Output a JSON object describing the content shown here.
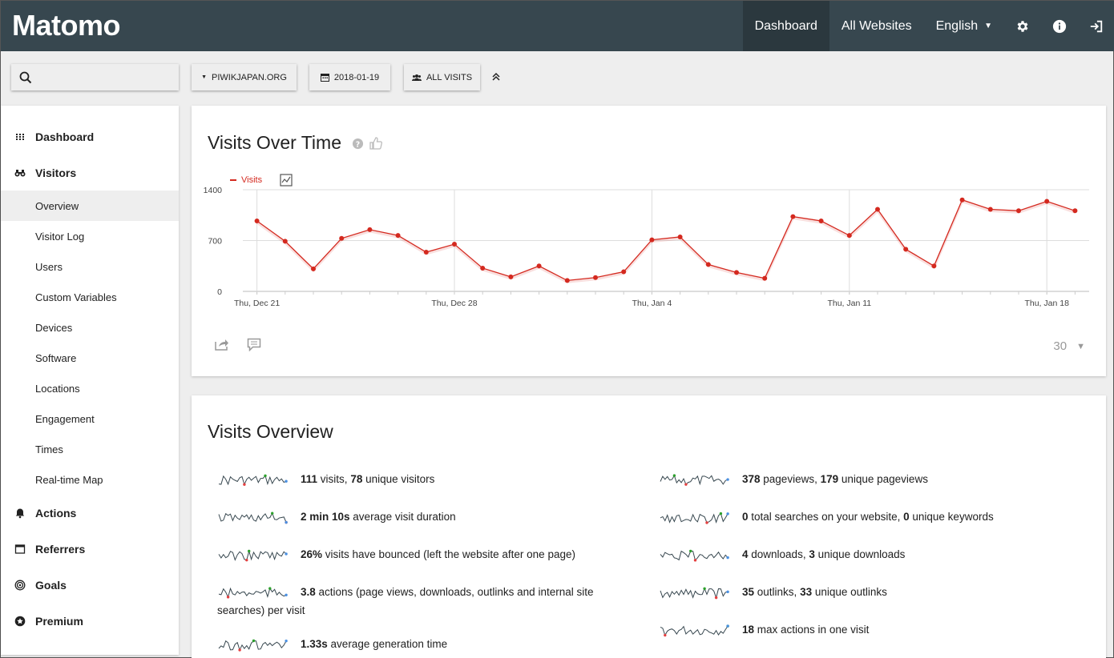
{
  "app": {
    "logo": "Matomo"
  },
  "topnav": {
    "items": [
      {
        "label": "Dashboard",
        "active": true
      },
      {
        "label": "All Websites",
        "active": false
      },
      {
        "label": "English",
        "active": false
      }
    ],
    "icons": [
      "gear-icon",
      "info-icon",
      "sign-out-icon"
    ]
  },
  "filters": {
    "site": "PIWIKJAPAN.ORG",
    "date": "2018-01-19",
    "segment": "ALL VISITS"
  },
  "sidebar": {
    "categories": [
      {
        "label": "Dashboard",
        "icon": "grid-icon"
      },
      {
        "label": "Visitors",
        "icon": "binoculars-icon"
      },
      {
        "label": "Actions",
        "icon": "bell-icon"
      },
      {
        "label": "Referrers",
        "icon": "window-icon"
      },
      {
        "label": "Goals",
        "icon": "target-icon"
      },
      {
        "label": "Premium",
        "icon": "star-circle-icon"
      }
    ],
    "visitors_sub": [
      "Overview",
      "Visitor Log",
      "Users",
      "Custom Variables",
      "Devices",
      "Software",
      "Locations",
      "Engagement",
      "Times",
      "Real-time Map"
    ],
    "active_sub": "Overview"
  },
  "visits_over_time": {
    "title": "Visits Over Time",
    "limit": "30"
  },
  "chart_data": {
    "type": "line",
    "title": "Visits Over Time",
    "series": [
      {
        "name": "Visits",
        "color": "#d4291f",
        "values": [
          970,
          690,
          310,
          730,
          850,
          770,
          540,
          650,
          320,
          200,
          350,
          150,
          190,
          270,
          710,
          750,
          370,
          260,
          180,
          1030,
          970,
          770,
          1130,
          580,
          350,
          1260,
          1130,
          1110,
          1240,
          1110
        ]
      }
    ],
    "x_tick_labels": [
      "Thu, Dec 21",
      "Thu, Dec 28",
      "Thu, Jan 4",
      "Thu, Jan 11",
      "Thu, Jan 18"
    ],
    "x_tick_indices": [
      0,
      7,
      14,
      21,
      28
    ],
    "y_ticks": [
      0,
      700,
      1400
    ],
    "ylim": [
      0,
      1400
    ],
    "grid": true,
    "legend": "top-left"
  },
  "visits_overview": {
    "title": "Visits Overview",
    "left": [
      {
        "b1": "111",
        "t1": " visits, ",
        "b2": "78",
        "t2": " unique visitors"
      },
      {
        "b1": "2 min 10s",
        "t1": " average visit duration",
        "b2": "",
        "t2": ""
      },
      {
        "b1": "26%",
        "t1": " visits have bounced (left the website after one page)",
        "b2": "",
        "t2": ""
      },
      {
        "b1": "3.8",
        "t1": " actions (page views, downloads, outlinks and internal site searches) per visit",
        "b2": "",
        "t2": ""
      },
      {
        "b1": "1.33s",
        "t1": " average generation time",
        "b2": "",
        "t2": ""
      }
    ],
    "right": [
      {
        "b1": "378",
        "t1": " pageviews, ",
        "b2": "179",
        "t2": " unique pageviews"
      },
      {
        "b1": "0",
        "t1": " total searches on your website, ",
        "b2": "0",
        "t2": " unique keywords"
      },
      {
        "b1": "4",
        "t1": " downloads, ",
        "b2": "3",
        "t2": " unique downloads"
      },
      {
        "b1": "35",
        "t1": " outlinks, ",
        "b2": "33",
        "t2": " unique outlinks"
      },
      {
        "b1": "18",
        "t1": " max actions in one visit",
        "b2": "",
        "t2": ""
      }
    ]
  }
}
